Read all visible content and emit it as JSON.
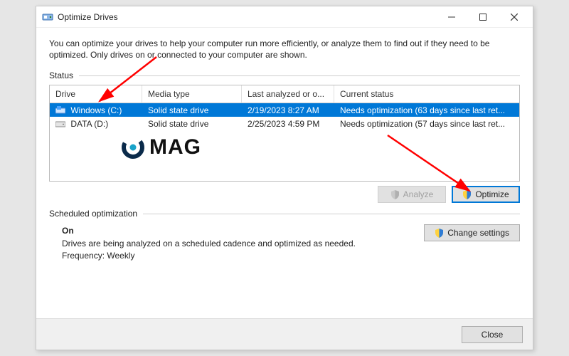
{
  "window": {
    "title": "Optimize Drives",
    "description": "You can optimize your drives to help your computer run more efficiently, or analyze them to find out if they need to be optimized. Only drives on or connected to your computer are shown."
  },
  "status": {
    "label": "Status",
    "columns": {
      "drive": "Drive",
      "media": "Media type",
      "last": "Last analyzed or o...",
      "current": "Current status"
    },
    "rows": [
      {
        "name": "Windows (C:)",
        "media": "Solid state drive",
        "last": "2/19/2023 8:27 AM",
        "current": "Needs optimization (63 days since last ret...",
        "icon": "drive-os",
        "selected": true
      },
      {
        "name": "DATA (D:)",
        "media": "Solid state drive",
        "last": "2/25/2023 4:59 PM",
        "current": "Needs optimization (57 days since last ret...",
        "icon": "drive",
        "selected": false
      }
    ]
  },
  "buttons": {
    "analyze": "Analyze",
    "optimize": "Optimize",
    "change_settings": "Change settings",
    "close": "Close"
  },
  "schedule": {
    "label": "Scheduled optimization",
    "state": "On",
    "desc": "Drives are being analyzed on a scheduled cadence and optimized as needed.",
    "freq": "Frequency: Weekly"
  },
  "watermark": {
    "text": "MAG"
  }
}
